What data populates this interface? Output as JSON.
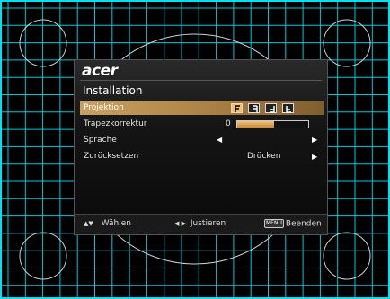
{
  "brand": {
    "logo_text": "acer"
  },
  "menu": {
    "title": "Installation",
    "items": [
      {
        "label": "Projektion",
        "type": "icons",
        "selected": true
      },
      {
        "label": "Trapezkorrektur",
        "type": "slider",
        "value": "0",
        "fill_fraction": 0.52
      },
      {
        "label": "Sprache",
        "type": "arrows",
        "value": ""
      },
      {
        "label": "Zurücksetzen",
        "type": "action",
        "value": "Drücken"
      }
    ],
    "projection_modes": [
      {
        "icon": "front-desk-projection-icon",
        "glyph": "F",
        "active": true
      },
      {
        "icon": "rear-desk-projection-icon",
        "glyph": "Ⅎ",
        "active": false
      },
      {
        "icon": "front-ceiling-projection-icon",
        "glyph": "ꟻ",
        "active": false
      },
      {
        "icon": "rear-ceiling-projection-icon",
        "glyph": "L",
        "active": false
      }
    ]
  },
  "footer": {
    "select": {
      "keys": "▲▼",
      "label": "Wählen"
    },
    "adjust": {
      "keys": "◀ ▶",
      "label": "Justieren"
    },
    "exit": {
      "key": "MENU",
      "label": "Beenden"
    }
  },
  "colors": {
    "grid_line": "#00c8d8",
    "highlight": "#c9a161",
    "osd_background": "#141414"
  }
}
